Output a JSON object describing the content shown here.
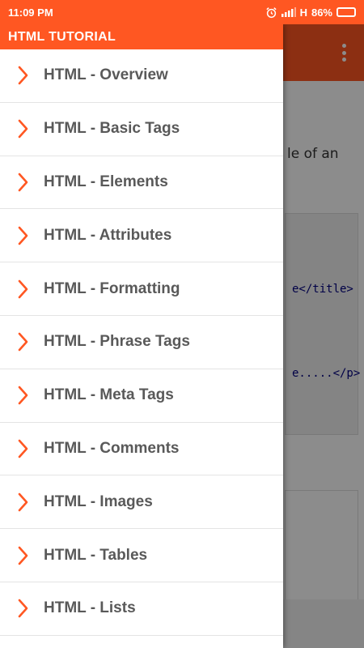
{
  "status_bar": {
    "time": "11:09 PM",
    "network": "H",
    "battery": "86%",
    "battery_level": 0.86,
    "icons": [
      "alarm-icon",
      "signal-icon",
      "battery-icon"
    ]
  },
  "drawer": {
    "title": "HTML TUTORIAL",
    "items": [
      {
        "label": "HTML - Overview"
      },
      {
        "label": "HTML - Basic Tags"
      },
      {
        "label": "HTML - Elements"
      },
      {
        "label": "HTML - Attributes"
      },
      {
        "label": "HTML - Formatting"
      },
      {
        "label": "HTML - Phrase Tags"
      },
      {
        "label": "HTML - Meta Tags"
      },
      {
        "label": "HTML - Comments"
      },
      {
        "label": "HTML - Images"
      },
      {
        "label": "HTML - Tables"
      },
      {
        "label": "HTML - Lists"
      }
    ]
  },
  "background": {
    "text_fragment": "le of an",
    "code_line_1": "e</title>",
    "code_line_2": "e.....</p>",
    "menu_icon": "overflow-menu-icon"
  },
  "colors": {
    "accent": "#ff5722",
    "chevron": "#ff5722",
    "item_text": "#595959",
    "divider": "#e4e4e4"
  }
}
